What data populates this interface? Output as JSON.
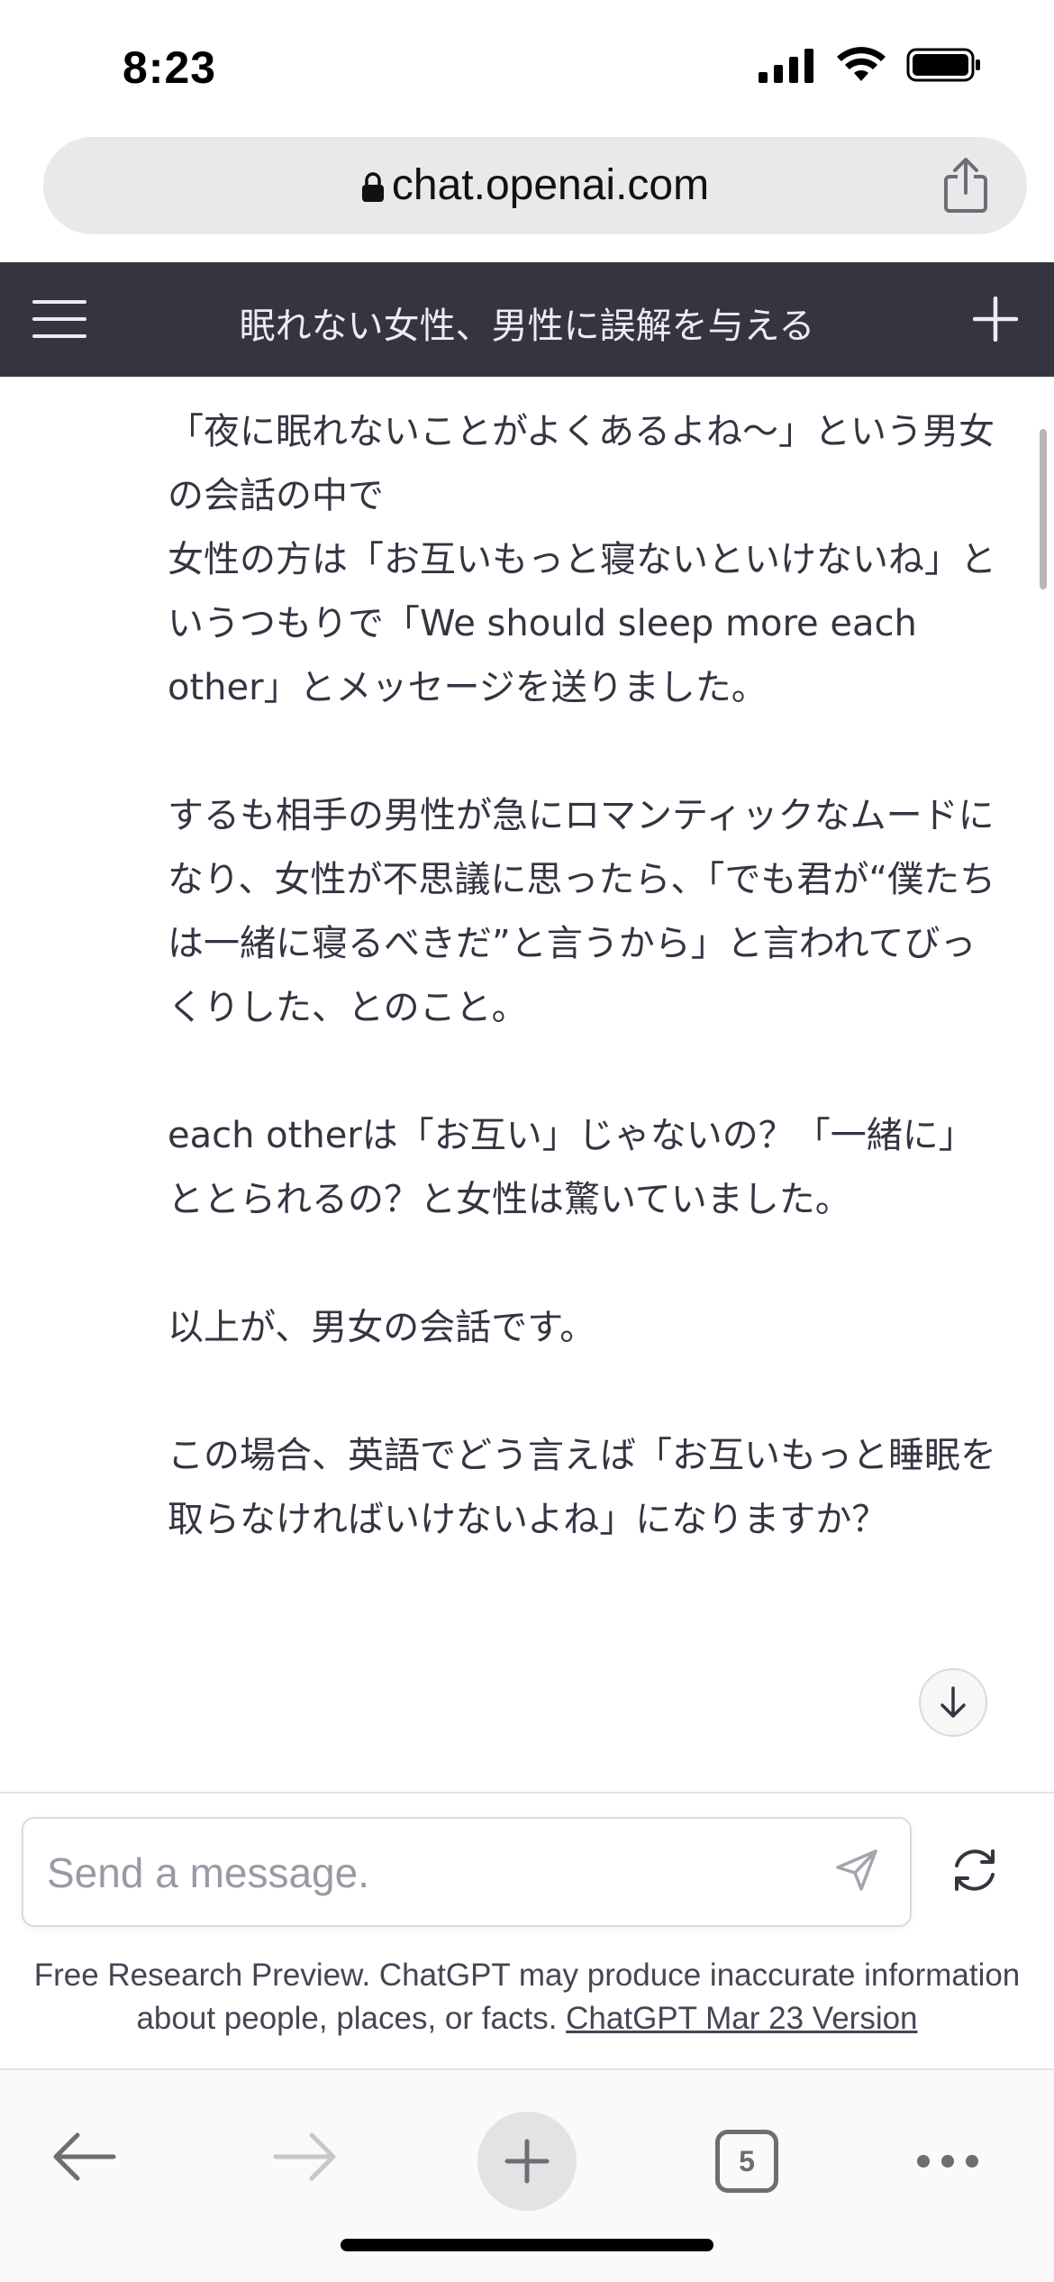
{
  "status_bar": {
    "time": "8:23"
  },
  "browser": {
    "url": "chat.openai.com",
    "tab_count": "5"
  },
  "header": {
    "title": "眠れない女性、男性に誤解を与える"
  },
  "message": {
    "paragraphs": [
      "「夜に眠れないことがよくあるよね〜」という男女の会話の中で\n女性の方は「お互いもっと寝ないといけないね」というつもりで「We should sleep more each other」とメッセージを送りました。",
      "するも相手の男性が急にロマンティックなムードになり、女性が不思議に思ったら、「でも君が“僕たちは一緒に寝るべきだ”と言うから」と言われてびっくりした、とのこと。",
      "each otherは「お互い」じゃないの？「一緒に」ととられるの？と女性は驚いていました。",
      "以上が、男女の会話です。",
      "この場合、英語でどう言えば「お互いもっと睡眠を取らなければいけないよね」になりますか？"
    ]
  },
  "composer": {
    "placeholder": "Send a message."
  },
  "disclaimer": {
    "text": "Free Research Preview. ChatGPT may produce inaccurate information about people, places, or facts.",
    "link": "ChatGPT Mar 23 Version"
  },
  "icons": {
    "lock": "lock-icon",
    "share": "share-icon",
    "menu": "menu-icon",
    "new_chat": "plus-icon",
    "scroll_down": "arrow-down-icon",
    "send": "paper-plane-icon",
    "regenerate": "refresh-icon",
    "back": "arrow-left-icon",
    "forward": "arrow-right-icon",
    "new_tab": "plus-icon",
    "more": "ellipsis-icon"
  },
  "colors": {
    "header_bg": "#343541",
    "text": "#343541",
    "url_bar_bg": "#e9e9eb"
  }
}
